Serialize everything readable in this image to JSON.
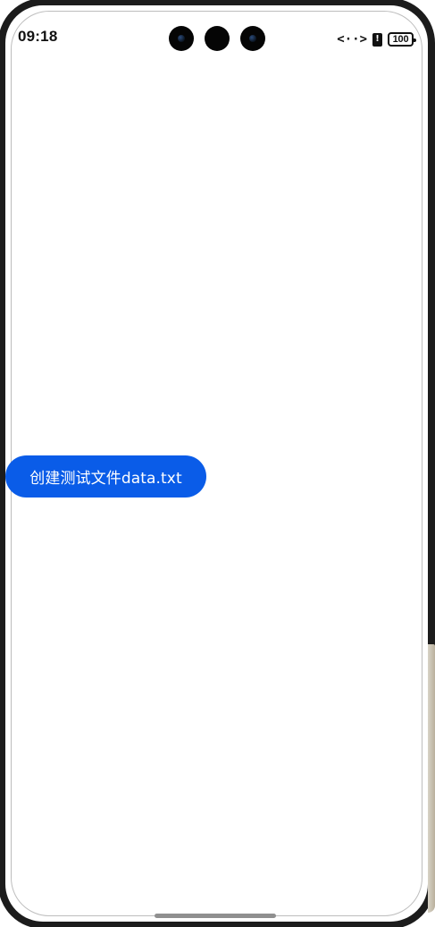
{
  "status_bar": {
    "time": "09:18",
    "developer_icon": "developer-mode-icon",
    "alert_icon": "notification-alert-icon",
    "battery_level": "100"
  },
  "main": {
    "create_button_label": "创建测试文件data.txt"
  },
  "colors": {
    "accent": "#0a5ce8",
    "frame": "#1c1c1c",
    "background": "#ffffff",
    "home_indicator": "#8f8f8f"
  }
}
